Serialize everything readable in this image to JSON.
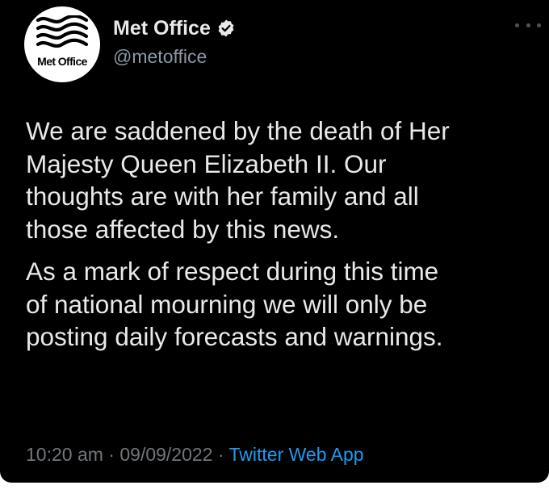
{
  "tweet": {
    "author": {
      "display_name": "Met Office",
      "handle": "@metoffice",
      "verified": true,
      "avatar_label": "Met Office",
      "avatar_icon": "wave-logo-icon"
    },
    "paragraphs": [
      "We are saddened by the death of Her\nMajesty Queen Elizabeth II. Our\nthoughts are with her family and all\nthose affected by this news.",
      "As a mark of respect during this time\nof national mourning we will only be\nposting daily forecasts and warnings."
    ],
    "time": "10:20 am",
    "separator": " · ",
    "date": "09/09/2022",
    "source": "Twitter Web App"
  },
  "colors": {
    "background": "#000000",
    "text": "#e7e9ea",
    "muted": "#71767b",
    "accent": "#1d9bf0"
  }
}
